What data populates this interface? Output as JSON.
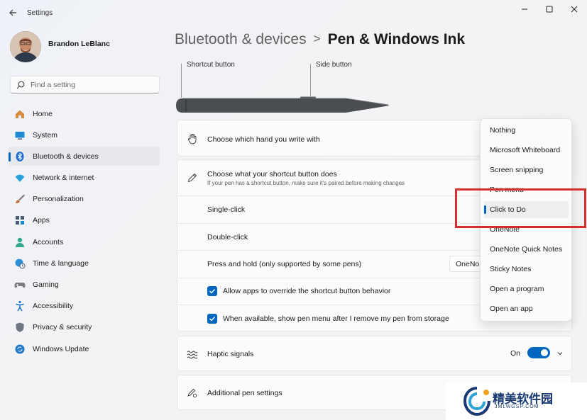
{
  "window": {
    "app_title": "Settings",
    "controls": {
      "minimize": "—",
      "maximize": "☐",
      "close": "✕"
    }
  },
  "profile": {
    "name": "Brandon LeBlanc"
  },
  "search": {
    "placeholder": "Find a setting"
  },
  "sidebar": {
    "items": [
      {
        "label": "Home",
        "icon": "home-icon",
        "color": "#d88a3c"
      },
      {
        "label": "System",
        "icon": "system-icon",
        "color": "#1e8ad6"
      },
      {
        "label": "Bluetooth & devices",
        "icon": "bluetooth-icon",
        "color": "#1f6fd0",
        "active": true
      },
      {
        "label": "Network & internet",
        "icon": "wifi-icon",
        "color": "#2aa0d8"
      },
      {
        "label": "Personalization",
        "icon": "brush-icon",
        "color": "#c76b2f"
      },
      {
        "label": "Apps",
        "icon": "apps-icon",
        "color": "#4b5d7a"
      },
      {
        "label": "Accounts",
        "icon": "accounts-icon",
        "color": "#2eaa8a"
      },
      {
        "label": "Time & language",
        "icon": "globe-clock-icon",
        "color": "#2a8fd6"
      },
      {
        "label": "Gaming",
        "icon": "gamepad-icon",
        "color": "#7c7c84"
      },
      {
        "label": "Accessibility",
        "icon": "accessibility-icon",
        "color": "#1f78c8"
      },
      {
        "label": "Privacy & security",
        "icon": "shield-icon",
        "color": "#6f7682"
      },
      {
        "label": "Windows Update",
        "icon": "update-icon",
        "color": "#1f78c8"
      }
    ]
  },
  "breadcrumb": {
    "parent": "Bluetooth & devices",
    "separator": ">",
    "current": "Pen & Windows Ink"
  },
  "pen": {
    "shortcut_label": "Shortcut button",
    "side_label": "Side button"
  },
  "settings": {
    "hand": {
      "label": "Choose which hand you write with"
    },
    "shortcut": {
      "label": "Choose what your shortcut button does",
      "sublabel": "If your pen has a shortcut button, make sure it's paired before making changes"
    },
    "single_click": {
      "label": "Single-click"
    },
    "double_click": {
      "label": "Double-click"
    },
    "press_hold": {
      "label": "Press and hold (only supported by some pens)",
      "value": "OneNo"
    },
    "allow_override": {
      "label": "Allow apps to override the shortcut button behavior",
      "checked": true
    },
    "show_pen_menu": {
      "label": "When available, show pen menu after I remove my pen from storage",
      "checked": true
    },
    "haptic": {
      "label": "Haptic signals",
      "state": "On"
    },
    "additional": {
      "label": "Additional pen settings"
    }
  },
  "dropdown": {
    "options": [
      "Nothing",
      "Microsoft Whiteboard",
      "Screen snipping",
      "Pen menu",
      "Click to Do",
      "OneNote",
      "OneNote Quick Notes",
      "Sticky Notes",
      "Open a program",
      "Open an app"
    ],
    "selected": "Click to Do"
  },
  "watermark": {
    "text": "精美软件园",
    "sub": "JMLWGSP.COM"
  },
  "colors": {
    "accent": "#0067c0",
    "highlight": "#d32f2f"
  }
}
